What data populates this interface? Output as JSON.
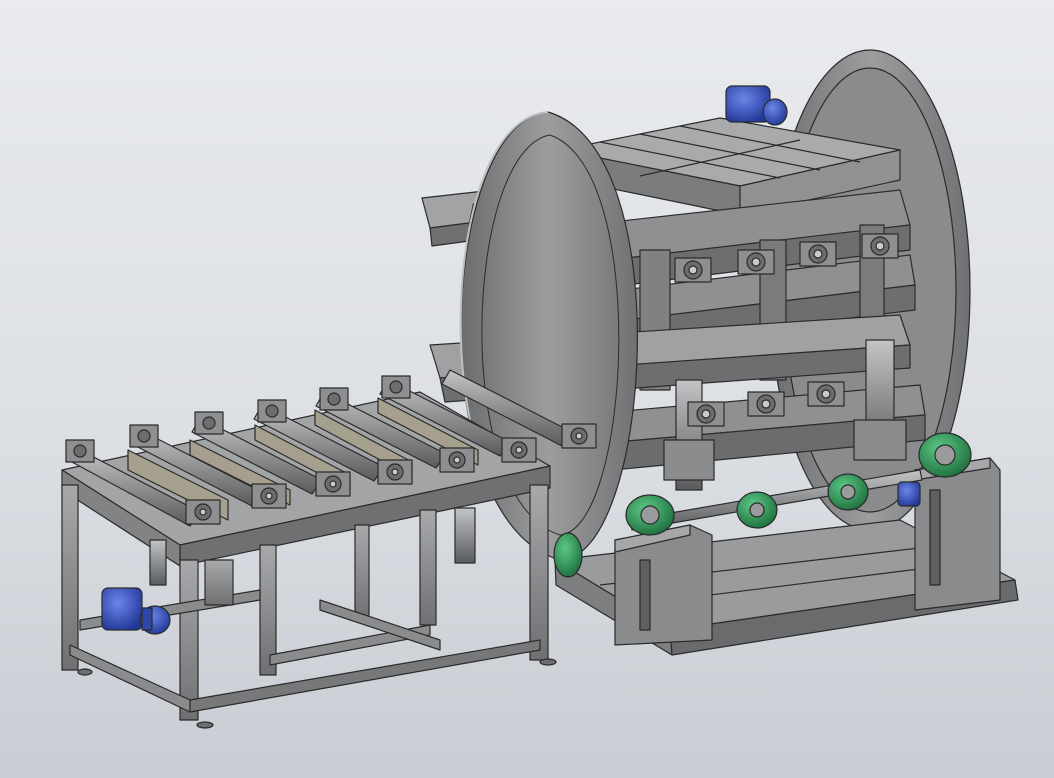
{
  "scene": {
    "description_visible_text": "",
    "colors": {
      "background_top": "#e9ebee",
      "background_bottom": "#c9cdd3",
      "steel": "#8e8f90",
      "steel_dark": "#5e5f61",
      "steel_light": "#b4b5b6",
      "roller": "#9a9b9d",
      "pad_tan": "#a59f8e",
      "motor_blue": "#3b55b8",
      "bearing_green": "#2f9a5a",
      "edge": "#2b2b2b"
    },
    "icons": [
      "motor-icon",
      "bearing-block-icon"
    ]
  }
}
